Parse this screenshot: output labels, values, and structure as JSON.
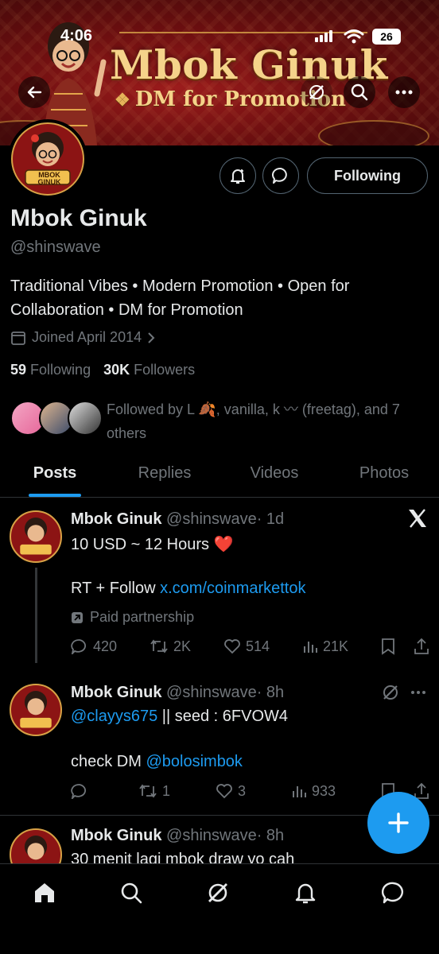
{
  "status_bar": {
    "time": "4:06",
    "battery": "26"
  },
  "banner": {
    "title": "Mbok Ginuk",
    "subtitle": "DM for Promotion"
  },
  "avatar_logo_text": "MBOK GINUK",
  "header_buttons": {
    "following_label": "Following"
  },
  "profile": {
    "name": "Mbok Ginuk",
    "handle": "@shinswave",
    "bio": "Traditional Vibes • Modern Promotion • Open for Collaboration • DM for Promotion",
    "joined": "Joined April 2014",
    "following_count": "59",
    "following_label": "Following",
    "followers_count": "30K",
    "followers_label": "Followers",
    "followed_by": "Followed by L 🍂, vanilla, k 〰 (freetag), and 7 others"
  },
  "tabs": [
    "Posts",
    "Replies",
    "Videos",
    "Photos"
  ],
  "posts": [
    {
      "name": "Mbok Ginuk",
      "handle": "@shinswave",
      "time": "· 1d",
      "line1": "10 USD ~ 12 Hours ❤️",
      "line2_prefix": "RT + Follow ",
      "line2_link": "x.com/coinmarkettok",
      "paid": "Paid partnership",
      "replies": "420",
      "reposts": "2K",
      "likes": "514",
      "views": "21K"
    },
    {
      "name": "Mbok Ginuk",
      "handle": "@shinswave",
      "time": "· 8h",
      "line1_link": "@clayys675",
      "line1_rest": " || seed : 6FVOW4",
      "line2_prefix": "check DM ",
      "line2_link": "@bolosimbok",
      "replies": "",
      "reposts": "1",
      "likes": "3",
      "views": "933"
    },
    {
      "name": "Mbok Ginuk",
      "handle": "@shinswave",
      "time": "· 8h",
      "line1": "30 menit lagi mbok draw yo cah"
    }
  ],
  "colors": {
    "accent": "#1d9bf0",
    "background": "#000000",
    "muted": "#71767b",
    "banner_red": "#8c1414",
    "gold": "#f5d38a"
  }
}
